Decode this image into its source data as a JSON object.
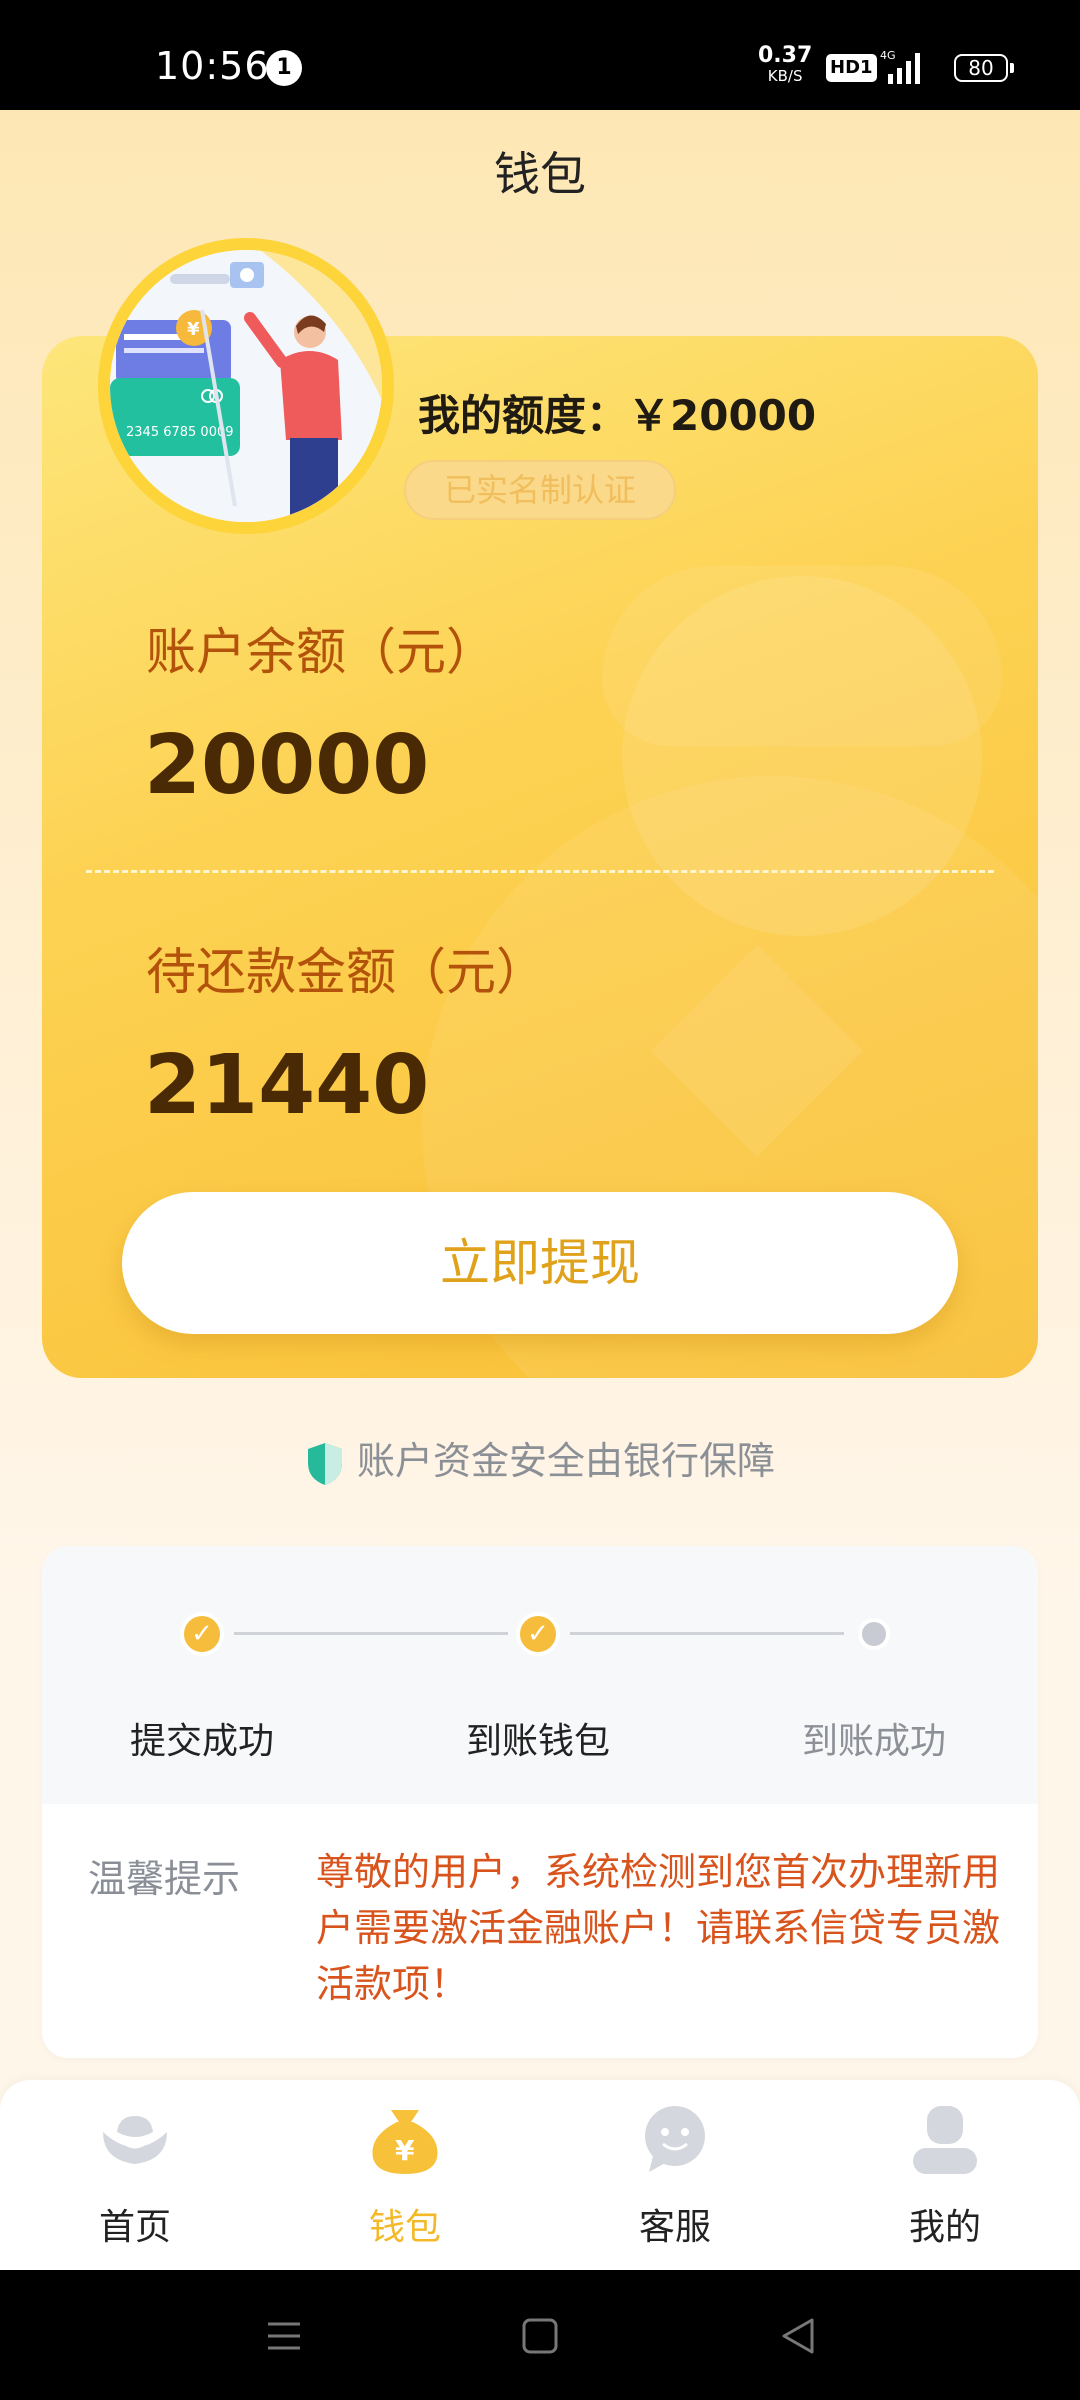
{
  "status_bar": {
    "time": "10:56",
    "notification_count": "1",
    "net_speed_value": "0.37",
    "net_speed_unit": "KB/S",
    "hd_label": "HD1",
    "network_label": "4G",
    "battery": "80"
  },
  "header": {
    "title": "钱包"
  },
  "wallet": {
    "quota_label": "我的额度：",
    "quota_value": "￥20000",
    "verified_badge": "已实名制认证",
    "balance_label": "账户余额（元）",
    "balance_value": "20000",
    "repay_label": "待还款金额（元）",
    "repay_value": "21440",
    "withdraw_button": "立即提现"
  },
  "security_note": "账户资金安全由银行保障",
  "progress": {
    "steps": [
      {
        "label": "提交成功",
        "status": "done"
      },
      {
        "label": "到账钱包",
        "status": "done"
      },
      {
        "label": "到账成功",
        "status": "pending"
      }
    ],
    "tip_title": "温馨提示",
    "tip_text": "尊敬的用户，系统检测到您首次办理新用户需要激活金融账户！请联系信贷专员激活款项！"
  },
  "tabbar": {
    "active": "钱包",
    "items": [
      {
        "label": "首页",
        "icon": "ingot-icon"
      },
      {
        "label": "钱包",
        "icon": "money-bag-icon"
      },
      {
        "label": "客服",
        "icon": "chat-bubble-icon"
      },
      {
        "label": "我的",
        "icon": "user-icon"
      }
    ]
  },
  "colors": {
    "accent": "#f3b928",
    "card_gradient_start": "#fde67b",
    "card_gradient_end": "#f9c036",
    "label_brown": "#b3520a",
    "tip_red": "#d9541c"
  }
}
